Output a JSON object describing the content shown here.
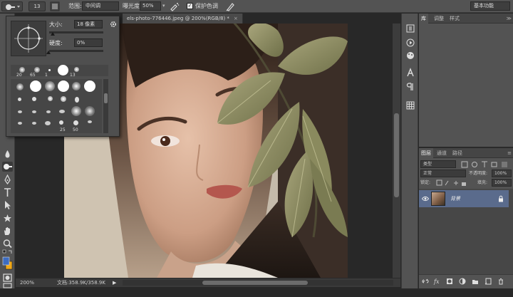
{
  "options_bar": {
    "brush_size": "13",
    "range_label": "范围:",
    "range_value": "中间调",
    "exposure_label": "曝光度:",
    "exposure_value": "50%",
    "protect_label": "保护色调",
    "protect_checked": true,
    "workspace": "基本功能"
  },
  "document": {
    "tab_title": "els-photo-776446.jpeg @ 200%(RGB/8) *",
    "close_glyph": "×"
  },
  "status_bar": {
    "zoom": "200%",
    "doc_info": "文档:358.9K/358.9K",
    "arrow": "▶"
  },
  "brush_popup": {
    "size_label": "大小:",
    "size_value": "18 像素",
    "hardness_label": "硬度:",
    "hardness_value": "0%",
    "recent_sizes": [
      "20",
      "65",
      "1",
      "13"
    ],
    "grid_sizes": [
      "25",
      "50"
    ]
  },
  "right_panel": {
    "top_tabs": [
      "库",
      "调整",
      "样式"
    ],
    "collapse_glyph": "≫"
  },
  "layers_panel": {
    "tabs": [
      "图层",
      "通道",
      "路径"
    ],
    "filter_kind": "类型",
    "blend_mode": "正常",
    "opacity_label": "不透明度:",
    "opacity_value": "100%",
    "lock_label": "锁定:",
    "fill_label": "填充:",
    "fill_value": "100%",
    "layer_name": "背景"
  },
  "colors": {
    "foreground": "#3d6cc0",
    "background": "#f0a818",
    "selected_layer": "#5a6b8c"
  }
}
